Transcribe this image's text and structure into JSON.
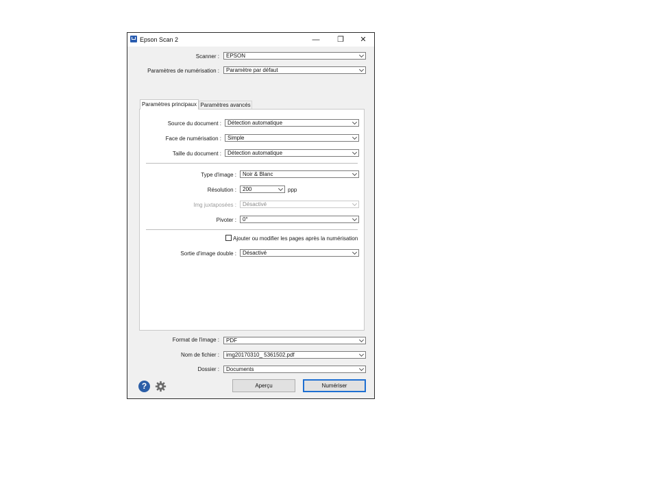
{
  "window": {
    "title": "Epson Scan 2",
    "controls": {
      "minimize": "—",
      "restore": "❐",
      "close": "✕"
    }
  },
  "top": {
    "scanner_label": "Scanner :",
    "scanner_value": "EPSON",
    "scan_settings_label": "Paramètres de numérisation :",
    "scan_settings_value": "Paramètre par défaut"
  },
  "tabs": [
    {
      "label": "Paramètres principaux",
      "active": true
    },
    {
      "label": "Paramètres avancés",
      "active": false
    }
  ],
  "main": {
    "document_source_label": "Source du document :",
    "document_source_value": "Détection automatique",
    "scan_side_label": "Face de numérisation :",
    "scan_side_value": "Simple",
    "document_size_label": "Taille du document :",
    "document_size_value": "Détection automatique",
    "image_type_label": "Type d'image :",
    "image_type_value": "Noir & Blanc",
    "resolution_label": "Résolution :",
    "resolution_value": "200",
    "resolution_unit": "ppp",
    "stitch_label": "Img juxtaposées :",
    "stitch_value": "Désactivé",
    "rotate_label": "Pivoter :",
    "rotate_value": "0°",
    "add_pages_label": "Ajouter ou modifier les pages après la numérisation",
    "add_pages_checked": false,
    "double_feed_label": "Sortie d'image double :",
    "double_feed_value": "Désactivé"
  },
  "bottom": {
    "image_format_label": "Format de l'image :",
    "image_format_value": "PDF",
    "file_name_label": "Nom de fichier :",
    "file_name_value": "img20170310_ 5361502.pdf",
    "folder_label": "Dossier :",
    "folder_value": "Documents",
    "preview_button": "Aperçu",
    "scan_button": "Numériser",
    "help_icon_glyph": "?"
  },
  "colors": {
    "accent": "#1e6fd1",
    "help_icon": "#2b5ea7",
    "gear_icon": "#6b6b6b"
  }
}
